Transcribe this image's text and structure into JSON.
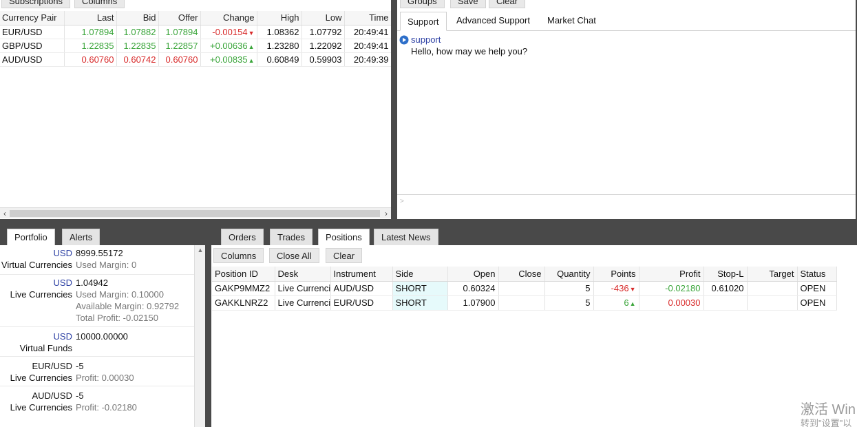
{
  "quotes_panel": {
    "buttons": [
      "Subscriptions",
      "Columns"
    ],
    "columns": [
      "Currency Pair",
      "Last",
      "Bid",
      "Offer",
      "Change",
      "High",
      "Low",
      "Time"
    ],
    "rows": [
      {
        "pair": "EUR/USD",
        "last": "1.07894",
        "bid": "1.07882",
        "offer": "1.07894",
        "change": "-0.00154",
        "high": "1.08362",
        "low": "1.07792",
        "time": "20:49:41",
        "color": "#3aa53a",
        "change_color": "#d82a2a",
        "arrow": "▼"
      },
      {
        "pair": "GBP/USD",
        "last": "1.22835",
        "bid": "1.22835",
        "offer": "1.22857",
        "change": "+0.00636",
        "high": "1.23280",
        "low": "1.22092",
        "time": "20:49:41",
        "color": "#3aa53a",
        "change_color": "#3aa53a",
        "arrow": "▲"
      },
      {
        "pair": "AUD/USD",
        "last": "0.60760",
        "bid": "0.60742",
        "offer": "0.60760",
        "change": "+0.00835",
        "high": "0.60849",
        "low": "0.59903",
        "time": "20:49:39",
        "color": "#d82a2a",
        "change_color": "#3aa53a",
        "arrow": "▲"
      }
    ]
  },
  "chat_panel": {
    "buttons": [
      "Groups",
      "Save",
      "Clear"
    ],
    "tabs": [
      "Support",
      "Advanced Support",
      "Market Chat"
    ],
    "active_tab": "Support",
    "messages": [
      {
        "sender": "support",
        "text": "Hello, how may we help you?"
      }
    ],
    "input_prompt": ">"
  },
  "portfolio_panel": {
    "tabs": [
      "Portfolio",
      "Alerts"
    ],
    "active_tab": "Portfolio",
    "blocks": [
      {
        "key1": "USD",
        "val1": "8999.55172",
        "key2": "Virtual Currencies",
        "val2_label": "Used Margin:",
        "val2": "0"
      },
      {
        "key1": "USD",
        "val1": "1.04942",
        "key2": "Live Currencies",
        "val2_label": "Used Margin:",
        "val2": "0.10000",
        "val3_label": "Available Margin:",
        "val3": "0.92792",
        "val4_label": "Total Profit:",
        "val4": "-0.02150"
      },
      {
        "key1": "USD",
        "val1": "10000.00000",
        "key2": "Virtual Funds"
      },
      {
        "key1": "EUR/USD",
        "val1": "-5",
        "key2": "Live Currencies",
        "val2_label": "Profit:",
        "val2": "0.00030"
      },
      {
        "key1": "AUD/USD",
        "val1": "-5",
        "key2": "Live Currencies",
        "val2_label": "Profit:",
        "val2": "-0.02180"
      }
    ]
  },
  "positions_panel": {
    "tabs": [
      "Orders",
      "Trades",
      "Positions",
      "Latest News"
    ],
    "active_tab": "Positions",
    "buttons": [
      "Columns",
      "Close All",
      "Clear"
    ],
    "columns": [
      "Position ID",
      "Desk",
      "Instrument",
      "Side",
      "Open",
      "Close",
      "Quantity",
      "Points",
      "Profit",
      "Stop-L",
      "Target",
      "Status"
    ],
    "rows": [
      {
        "id": "GAKP9MMZ2",
        "desk": "Live Currencies",
        "instrument": "AUD/USD",
        "side": "SHORT",
        "open": "0.60324",
        "close": "",
        "quantity": "5",
        "points": "-436",
        "points_arrow": "▼",
        "points_color": "#d82a2a",
        "profit": "-0.02180",
        "profit_color": "#3aa53a",
        "stop": "0.61020",
        "target": "",
        "status": "OPEN"
      },
      {
        "id": "GAKKLNRZ2",
        "desk": "Live Currencies",
        "instrument": "EUR/USD",
        "side": "SHORT",
        "open": "1.07900",
        "close": "",
        "quantity": "5",
        "points": "6",
        "points_arrow": "▲",
        "points_color": "#3aa53a",
        "profit": "0.00030",
        "profit_color": "#d82a2a",
        "stop": "",
        "target": "",
        "status": "OPEN"
      }
    ]
  },
  "watermark": {
    "line1": "激活 Win",
    "line2": "转到\"设置\"以"
  }
}
